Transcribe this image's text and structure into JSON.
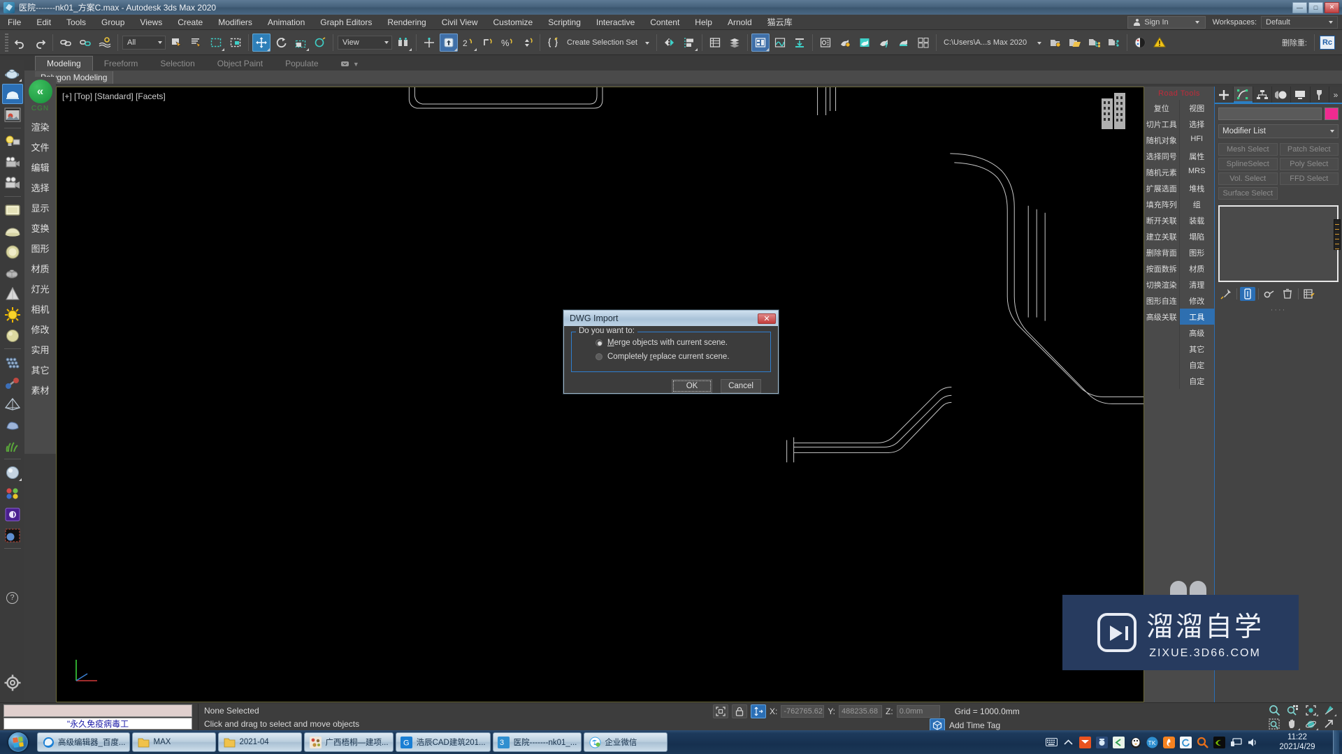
{
  "window": {
    "title": "医院-------nk01_方案C.max - Autodesk 3ds Max 2020",
    "minimize": "—",
    "maximize": "□",
    "close": "✕"
  },
  "menu": {
    "items": [
      "File",
      "Edit",
      "Tools",
      "Group",
      "Views",
      "Create",
      "Modifiers",
      "Animation",
      "Graph Editors",
      "Rendering",
      "Civil View",
      "Customize",
      "Scripting",
      "Interactive",
      "Content",
      "Help",
      "Arnold",
      "猫云库"
    ],
    "sign_in": "Sign In",
    "workspaces_label": "Workspaces:",
    "workspace_value": "Default"
  },
  "toolbar": {
    "selection_filter": "All",
    "reference_coordinate": "View",
    "named_selection_set": "Create Selection Set",
    "project_path": "C:\\Users\\A...s Max 2020",
    "delete_label": "删除重:",
    "rc_label": "Rc"
  },
  "ribbon": {
    "tabs": [
      "Modeling",
      "Freeform",
      "Selection",
      "Object Paint",
      "Populate"
    ],
    "selected_tab": "Modeling",
    "subtab": "Polygon Modeling"
  },
  "left_panel": {
    "brand": "CGN",
    "items": [
      "渲染",
      "文件",
      "编辑",
      "选择",
      "显示",
      "变换",
      "图形",
      "材质",
      "灯光",
      "相机",
      "修改",
      "实用",
      "其它",
      "素材"
    ]
  },
  "viewport": {
    "label": "[+] [Top] [Standard] [Facets]"
  },
  "right_quick_panel": {
    "header": "Road Tools",
    "left_column": [
      "复位",
      "切片工具",
      "随机对象",
      "选择同号",
      "随机元素",
      "扩展选面",
      "填充阵列",
      "断开关联",
      "建立关联",
      "删除背面",
      "按面数拆",
      "切换渲染",
      "图形自连",
      "高级关联"
    ],
    "right_column": [
      "视图",
      "选择",
      "HFI",
      "属性",
      "MRS",
      "堆栈",
      "组",
      "装载",
      "塌陷",
      "图形",
      "材质",
      "清理",
      "修改",
      "工具",
      "高级",
      "其它",
      "自定",
      "自定"
    ],
    "active_right": "工具"
  },
  "command_panel": {
    "tabs": [
      "create-tab",
      "modify-tab",
      "hierarchy-tab",
      "motion-tab",
      "display-tab",
      "utilities-tab"
    ],
    "selected_tab_index": 1,
    "object_name": "",
    "object_color": "#ef2a90",
    "modifier_list_label": "Modifier List",
    "modifier_buttons": [
      "Mesh Select",
      "Patch Select",
      "SplineSelect",
      "Poly Select",
      "Vol. Select",
      "FFD Select",
      "Surface Select"
    ],
    "stack_tools": [
      "pin-stack-icon",
      "show-end-result-icon",
      "make-unique-icon",
      "remove-modifier-icon",
      "configure-sets-icon"
    ]
  },
  "dialog": {
    "title": "DWG Import",
    "close_label": "✕",
    "group_label": "Do you want to:",
    "options": [
      {
        "label_before": "",
        "label_underline": "M",
        "label_after": "erge objects with current scene.",
        "selected": true
      },
      {
        "label_before": "Completely ",
        "label_underline": "r",
        "label_after": "eplace current scene.",
        "selected": false
      }
    ],
    "ok": "OK",
    "cancel": "Cancel"
  },
  "status": {
    "prompt_overlay": "\"永久免疫病毒工",
    "selection": "None Selected",
    "hint": "Click and drag to select and move objects",
    "x_label": "X:",
    "x_value": "-762765.62",
    "y_label": "Y:",
    "y_value": "488235.68",
    "z_label": "Z:",
    "z_value": "0.0mm",
    "grid": "Grid = 1000.0mm",
    "add_time_tag": "Add Time Tag"
  },
  "watermark": {
    "cn": "溜溜自学",
    "en": "ZIXUE.3D66.COM"
  },
  "taskbar": {
    "items": [
      {
        "label": "高级编辑器_百度...",
        "icon": "edge-icon",
        "color": "#1a7fd4"
      },
      {
        "label": "MAX",
        "icon": "folder-icon",
        "color": "#f0c24b"
      },
      {
        "label": "2021-04",
        "icon": "folder-icon",
        "color": "#f0c24b"
      },
      {
        "label": "广西梧桐—建项...",
        "icon": "image-icon",
        "color": "#c05a3a"
      },
      {
        "label": "浩辰CAD建筑201...",
        "icon": "gcad-icon",
        "color": "#1a7fd4"
      },
      {
        "label": "医院-------nk01_...",
        "icon": "max-icon",
        "color": "#2f8fd0"
      },
      {
        "label": "企业微信",
        "icon": "wecom-icon",
        "color": "#3ba3e8"
      }
    ],
    "tray": [
      "keyboard-icon",
      "show-hidden-icon",
      "foxmail-icon",
      "camera-icon",
      "editor-icon",
      "qq-icon",
      "tk-icon",
      "flame-icon",
      "sync-icon",
      "search-icon",
      "nvidia-icon",
      "network-icon",
      "volume-icon"
    ],
    "time": "11:22",
    "date": "2021/4/29"
  }
}
